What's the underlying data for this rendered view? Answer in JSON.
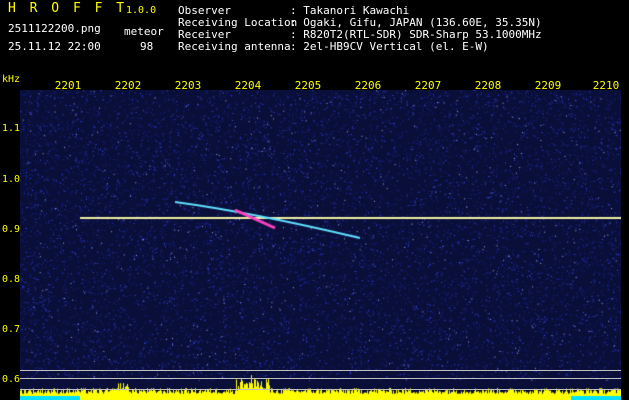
{
  "header": {
    "brand": "H R O F F T",
    "version": "1.0.0",
    "filename": "2511122200.png",
    "datetime": "25.11.12 22:00",
    "meteor_label": "meteor",
    "meteor_count": "98",
    "info": [
      {
        "label": "Observer",
        "value": ": Takanori Kawachi"
      },
      {
        "label": "Receiving Location",
        "value": ": Ogaki, Gifu, JAPAN (136.60E, 35.35N)"
      },
      {
        "label": "Receiver",
        "value": ": R820T2(RTL-SDR) SDR-Sharp 53.1000MHz"
      },
      {
        "label": "Receiving antenna",
        "value": ": 2el-HB9CV Vertical (el. E-W)"
      }
    ]
  },
  "spectrogram": {
    "y_unit": "kHz",
    "x_ticks": [
      "2201",
      "2202",
      "2203",
      "2204",
      "2205",
      "2206",
      "2207",
      "2208",
      "2209",
      "2210"
    ],
    "y_ticks": [
      "1.1",
      "1.0",
      "0.9",
      "0.8",
      "0.7",
      "0.6"
    ],
    "colors": {
      "background": "#0a0f3a",
      "noise": "#3a4cff",
      "carrier": "#f0f0a0",
      "echo_hot": "#ff40c0",
      "level_bar": "#ffff00",
      "level_base": "#00e0ff"
    }
  }
}
